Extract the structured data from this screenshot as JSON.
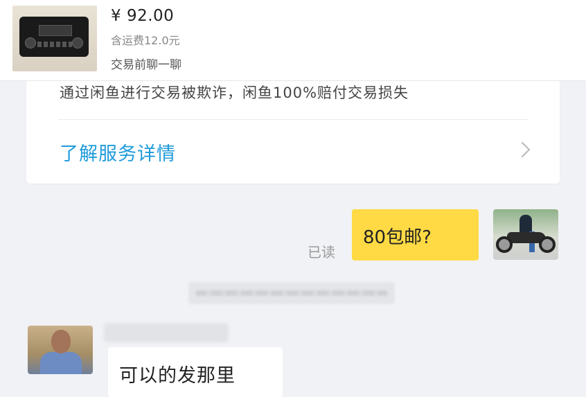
{
  "product": {
    "price": "¥ 92.00",
    "shipping": "含运费12.0元",
    "chat_prompt": "交易前聊一聊",
    "thumbnail_icon": "car-radio-thumbnail"
  },
  "service_card": {
    "text": "通过闲鱼进行交易被欺诈，闲鱼100%赔付交易损失",
    "link_label": "了解服务详情",
    "link_color": "#1f9bdb"
  },
  "messages": {
    "outgoing": {
      "text": "80包邮?",
      "status": "已读",
      "bubble_color": "#ffda44"
    },
    "incoming": {
      "text": "可以的发那里",
      "bubble_color": "#ffffff"
    }
  },
  "colors": {
    "background": "#f1f2f5",
    "accent": "#1f9bdb"
  }
}
